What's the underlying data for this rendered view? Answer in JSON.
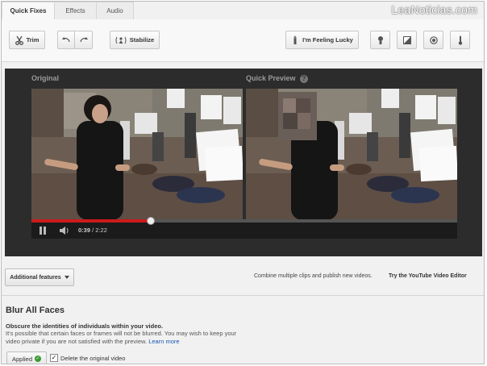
{
  "tabs": [
    {
      "label": "Quick Fixes"
    },
    {
      "label": "Effects"
    },
    {
      "label": "Audio"
    }
  ],
  "watermark": "LeaNoticias.com",
  "toolbar": {
    "trim_label": "Trim",
    "stabilize_label": "Stabilize",
    "lucky_label": "I'm Feeling Lucky"
  },
  "video": {
    "original_label": "Original",
    "preview_label": "Quick Preview",
    "help_glyph": "?",
    "time_current": "0:39",
    "time_total": "2:22",
    "time_separator": " / ",
    "progress": 0.28
  },
  "advanced": {
    "label": "Additional features",
    "combine_text": "Combine multiple clips and publish new videos.",
    "try_text": "Try the YouTube Video Editor"
  },
  "blur": {
    "title": "Blur All Faces",
    "subtitle": "Obscure the identities of individuals within your video.",
    "desc": "It's possible that certain faces or frames will not be blurred. You may wish to keep your video private if you are not satisfied with the preview.",
    "learn_more": "Learn more",
    "applied_label": "Applied",
    "delete_label": "Delete the original video",
    "delete_checked": true
  },
  "colors": {
    "progress": "#cc1b1b",
    "applied_check": "#3a9b34",
    "link": "#1a56b5"
  }
}
